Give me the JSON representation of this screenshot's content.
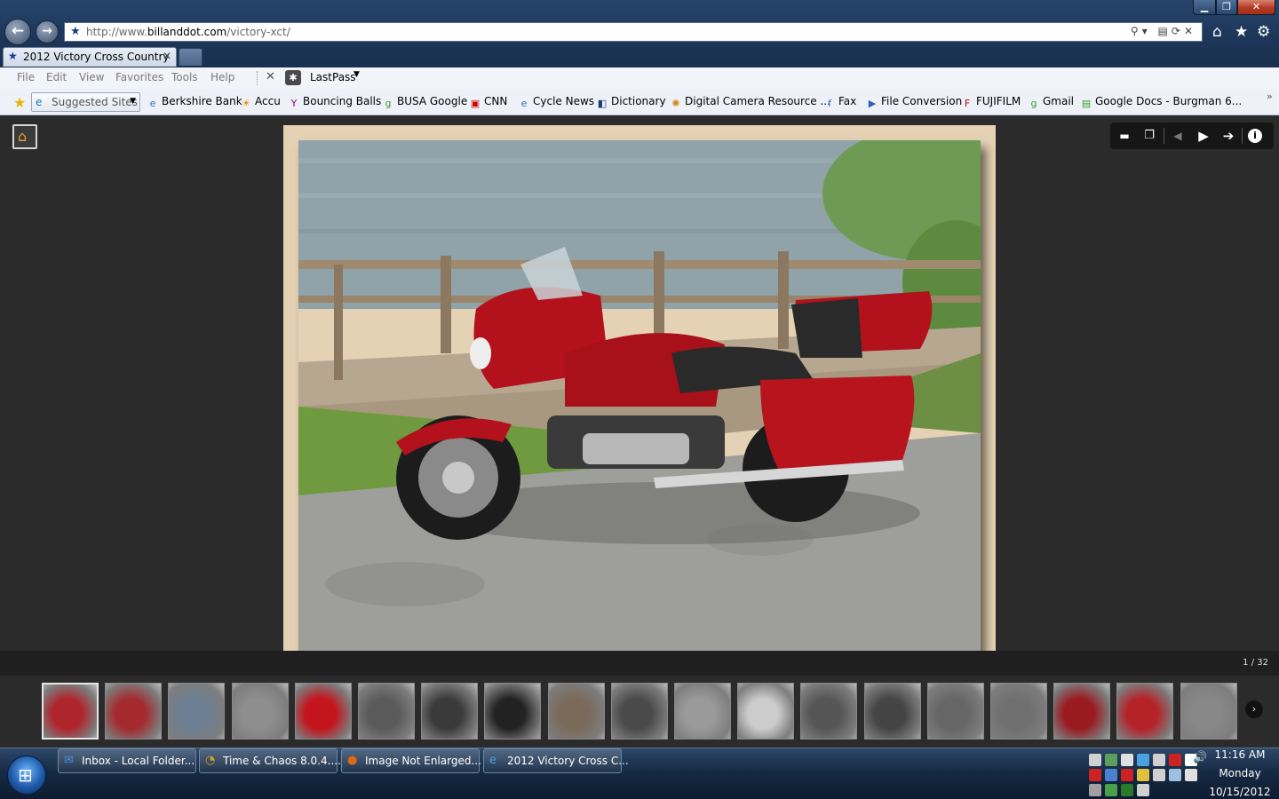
{
  "window": {
    "controls": {
      "minimize": "▁",
      "maximize": "❐",
      "close": "✕"
    }
  },
  "address_bar": {
    "url_prefix": "http://www.",
    "url_domain": "billanddot.com",
    "url_path": "/victory-xct/",
    "tools": "⚲▾ ▤⟳✕"
  },
  "tab": {
    "title": "2012 Victory Cross Country ...",
    "close": "✕"
  },
  "menu": {
    "items": [
      "File",
      "Edit",
      "View",
      "Favorites",
      "Tools",
      "Help"
    ],
    "lastpass_close": "✕",
    "lastpass_label": "LastPass"
  },
  "favorites": {
    "suggested_label": "Suggested Sites",
    "items": [
      {
        "label": "Berkshire Bank",
        "icon": "ie-page-icon",
        "color": "#2b6fb5"
      },
      {
        "label": "Accu",
        "icon": "weather-icon",
        "color": "#e68a00"
      },
      {
        "label": "Bouncing Balls",
        "icon": "yahoo-icon",
        "color": "#7b0099"
      },
      {
        "label": "BUSA Google",
        "icon": "google-icon",
        "color": "#3a9b2a"
      },
      {
        "label": "CNN",
        "icon": "cnn-icon",
        "color": "#cc0000"
      },
      {
        "label": "Cycle News",
        "icon": "ie-page-icon",
        "color": "#2b6fb5"
      },
      {
        "label": "Dictionary",
        "icon": "dictionary-icon",
        "color": "#1e3c78"
      },
      {
        "label": "Digital Camera Resource ...",
        "icon": "gear-site-icon",
        "color": "#d08a1a"
      },
      {
        "label": "Fax",
        "icon": "fz-icon",
        "color": "#2b6fb5"
      },
      {
        "label": "File Conversion",
        "icon": "arrow-site-icon",
        "color": "#3060b0"
      },
      {
        "label": "FUJIFILM",
        "icon": "fujifilm-icon",
        "color": "#c00000"
      },
      {
        "label": "Gmail",
        "icon": "google-icon",
        "color": "#3a9b2a"
      },
      {
        "label": "Google Docs - Burgman 6...",
        "icon": "docs-icon",
        "color": "#3a9b2a"
      }
    ],
    "more": "»"
  },
  "gallery": {
    "controls": [
      "grid-icon",
      "window-icon",
      "prev-icon",
      "play-icon",
      "next-icon",
      "info-icon"
    ],
    "control_glyphs": [
      "▬",
      "❐",
      "◀",
      "▶",
      "➔",
      "i"
    ],
    "counter": "1 / 32",
    "thumbnail_count": 19,
    "next_glyph": "›"
  },
  "taskbar": {
    "buttons": [
      {
        "label": "Inbox - Local Folder...",
        "icon": "thunderbird-icon",
        "color": "#4a8fe0"
      },
      {
        "label": "Time & Chaos 8.0.4....",
        "icon": "time-chaos-icon",
        "color": "#d0a020"
      },
      {
        "label": "Image Not Enlarged...",
        "icon": "firefox-icon",
        "color": "#e06a10"
      },
      {
        "label": "2012 Victory Cross C...",
        "icon": "ie-icon",
        "color": "#4aa0f0"
      }
    ],
    "clock": {
      "time": "11:16 AM",
      "day": "Monday",
      "date": "10/15/2012"
    }
  }
}
